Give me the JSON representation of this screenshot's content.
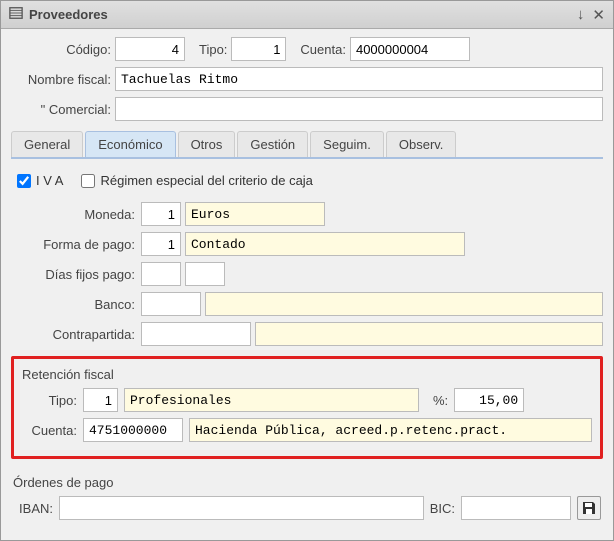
{
  "window": {
    "title": "Proveedores"
  },
  "header": {
    "codigo_label": "Código:",
    "codigo": "4",
    "tipo_label": "Tipo:",
    "tipo": "1",
    "cuenta_label": "Cuenta:",
    "cuenta": "4000000004",
    "nombre_fiscal_label": "Nombre fiscal:",
    "nombre_fiscal": "Tachuelas Ritmo",
    "comercial_label": "\"  Comercial:",
    "comercial": ""
  },
  "tabs": [
    "General",
    "Económico",
    "Otros",
    "Gestión",
    "Seguim.",
    "Observ."
  ],
  "checks": {
    "iva_label": "I V A",
    "iva_checked": true,
    "regimen_label": "Régimen especial del criterio de caja",
    "regimen_checked": false
  },
  "eco": {
    "moneda_label": "Moneda:",
    "moneda_code": "1",
    "moneda_text": "Euros",
    "forma_pago_label": "Forma de pago:",
    "forma_pago_code": "1",
    "forma_pago_text": "Contado",
    "dias_fijos_label": "Días fijos pago:",
    "dias_fijos_1": "",
    "dias_fijos_2": "",
    "banco_label": "Banco:",
    "banco_code": "",
    "banco_text": "",
    "contrapartida_label": "Contrapartida:",
    "contrapartida_code": "",
    "contrapartida_text": ""
  },
  "retencion": {
    "legend": "Retención fiscal",
    "tipo_label": "Tipo:",
    "tipo_code": "1",
    "tipo_text": "Profesionales",
    "percent_label": "%:",
    "percent": "15,00",
    "cuenta_label": "Cuenta:",
    "cuenta_code": "4751000000",
    "cuenta_text": "Hacienda Pública, acreed.p.retenc.pract."
  },
  "ordenes": {
    "legend": "Órdenes de pago",
    "iban_label": "IBAN:",
    "iban": "",
    "bic_label": "BIC:",
    "bic": ""
  }
}
